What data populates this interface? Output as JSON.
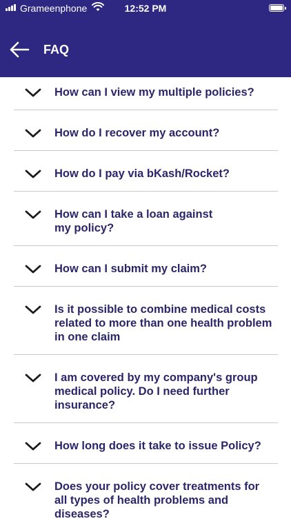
{
  "status_bar": {
    "carrier": "Grameenphone",
    "time": "12:52 PM"
  },
  "header": {
    "title": "FAQ"
  },
  "colors": {
    "header_bg": "#2e2883",
    "question_text": "#2b2669",
    "divider": "#c9c9c9"
  },
  "icons": {
    "back": "arrow-left-icon",
    "expand": "chevron-down-icon"
  },
  "faq": [
    {
      "question": "How can I view my multiple policies?"
    },
    {
      "question": "How do I recover my account?"
    },
    {
      "question": "How do I pay via bKash/Rocket?"
    },
    {
      "question": "How can I take a loan against my policy?"
    },
    {
      "question": "How can I submit my claim?"
    },
    {
      "question": "Is it possible to combine medical costs related to more than one health problem in one claim"
    },
    {
      "question": "I am covered by my company's group medical policy. Do I need further insurance?"
    },
    {
      "question": "How long does it take to issue Policy?"
    },
    {
      "question": "Does your policy cover treatments for all types of health problems and diseases?"
    }
  ]
}
